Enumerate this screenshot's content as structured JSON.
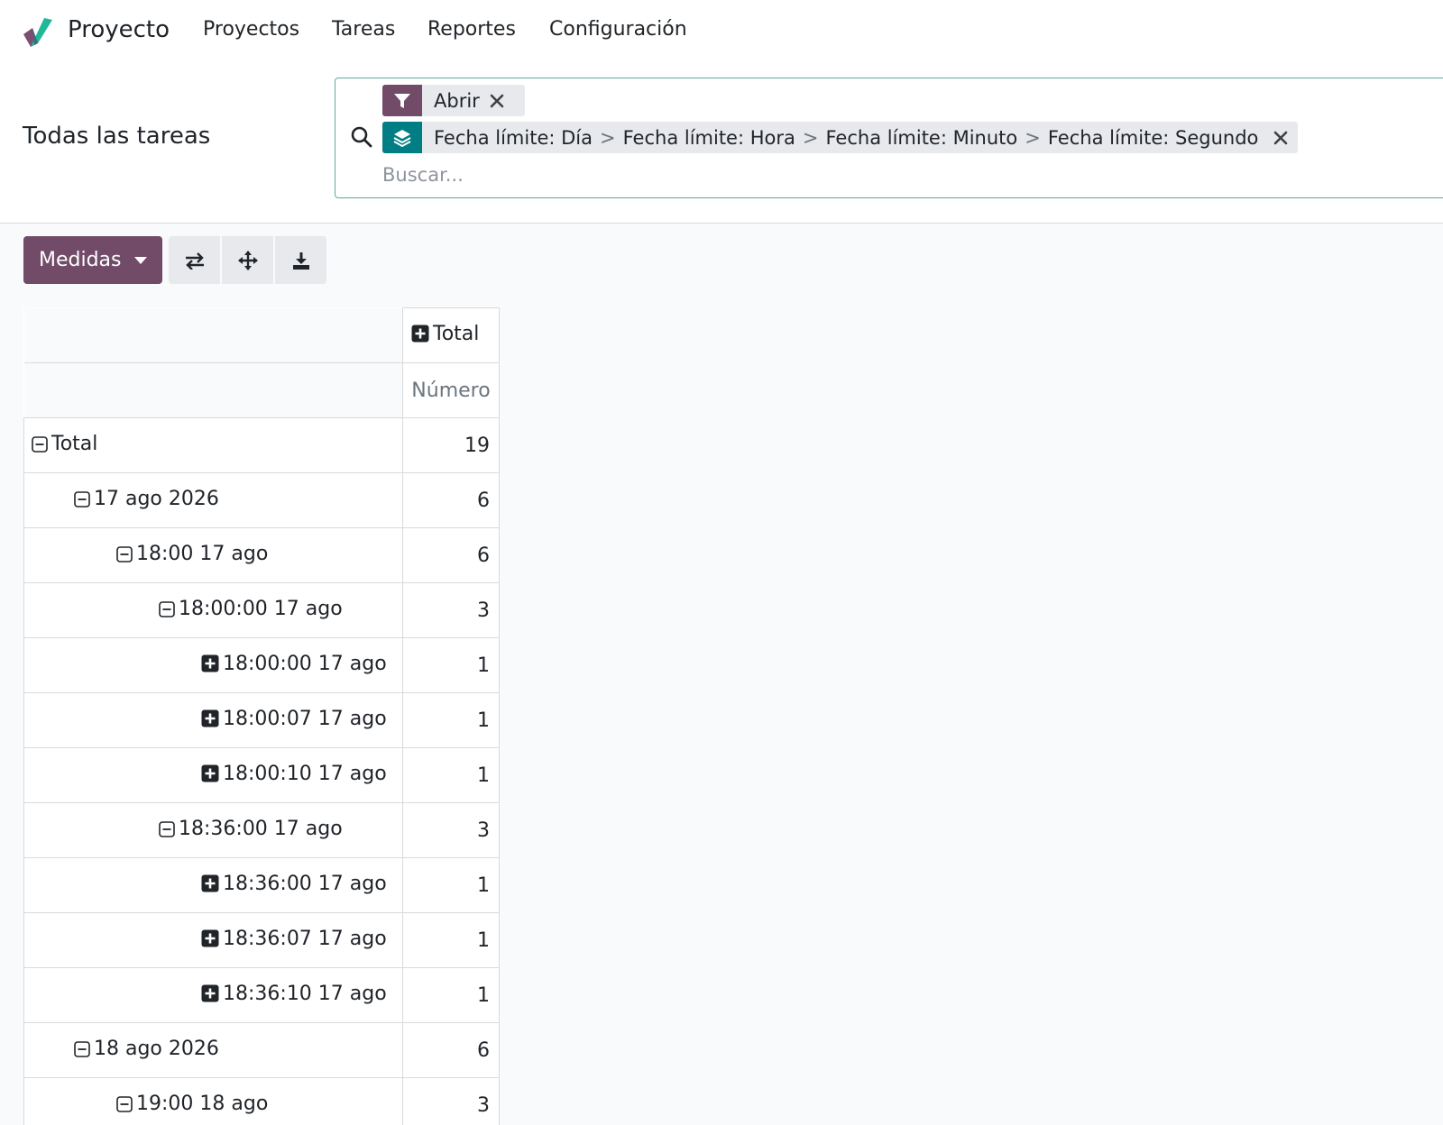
{
  "app": {
    "brand": "Proyecto",
    "brand_logo_icon": "odoo-checkmark-logo",
    "menu": [
      "Proyectos",
      "Tareas",
      "Reportes",
      "Configuración"
    ]
  },
  "control_panel": {
    "title": "Todas las tareas",
    "search": {
      "placeholder": "Buscar...",
      "value": "",
      "facets": [
        {
          "type": "filter",
          "icon": "filter-icon",
          "values": [
            "Abrir"
          ]
        },
        {
          "type": "groupby",
          "icon": "layers-icon",
          "separator": ">",
          "values": [
            "Fecha límite: Día",
            "Fecha límite: Hora",
            "Fecha límite: Minuto",
            "Fecha límite: Segundo"
          ]
        }
      ]
    }
  },
  "toolbar": {
    "measures_label": "Medidas",
    "buttons": [
      "flip-axis-icon",
      "expand-all-icon",
      "download-icon"
    ]
  },
  "pivot": {
    "column_header": "Total",
    "measure_header": "Número",
    "rows": [
      {
        "label": "Total",
        "value": "19",
        "level": 0,
        "state": "expanded"
      },
      {
        "label": "17 ago 2026",
        "value": "6",
        "level": 1,
        "state": "expanded"
      },
      {
        "label": "18:00 17 ago",
        "value": "6",
        "level": 2,
        "state": "expanded"
      },
      {
        "label": "18:00:00 17 ago",
        "value": "3",
        "level": 3,
        "state": "expanded"
      },
      {
        "label": "18:00:00 17 ago",
        "value": "1",
        "level": 4,
        "state": "collapsed"
      },
      {
        "label": "18:00:07 17 ago",
        "value": "1",
        "level": 4,
        "state": "collapsed"
      },
      {
        "label": "18:00:10 17 ago",
        "value": "1",
        "level": 4,
        "state": "collapsed"
      },
      {
        "label": "18:36:00 17 ago",
        "value": "3",
        "level": 3,
        "state": "expanded"
      },
      {
        "label": "18:36:00 17 ago",
        "value": "1",
        "level": 4,
        "state": "collapsed"
      },
      {
        "label": "18:36:07 17 ago",
        "value": "1",
        "level": 4,
        "state": "collapsed"
      },
      {
        "label": "18:36:10 17 ago",
        "value": "1",
        "level": 4,
        "state": "collapsed"
      },
      {
        "label": "18 ago 2026",
        "value": "6",
        "level": 1,
        "state": "expanded"
      },
      {
        "label": "19:00 18 ago",
        "value": "3",
        "level": 2,
        "state": "expanded"
      }
    ]
  },
  "colors": {
    "primary": "#714b67",
    "accent": "#017e84",
    "search_border": "#5fa8a2"
  }
}
